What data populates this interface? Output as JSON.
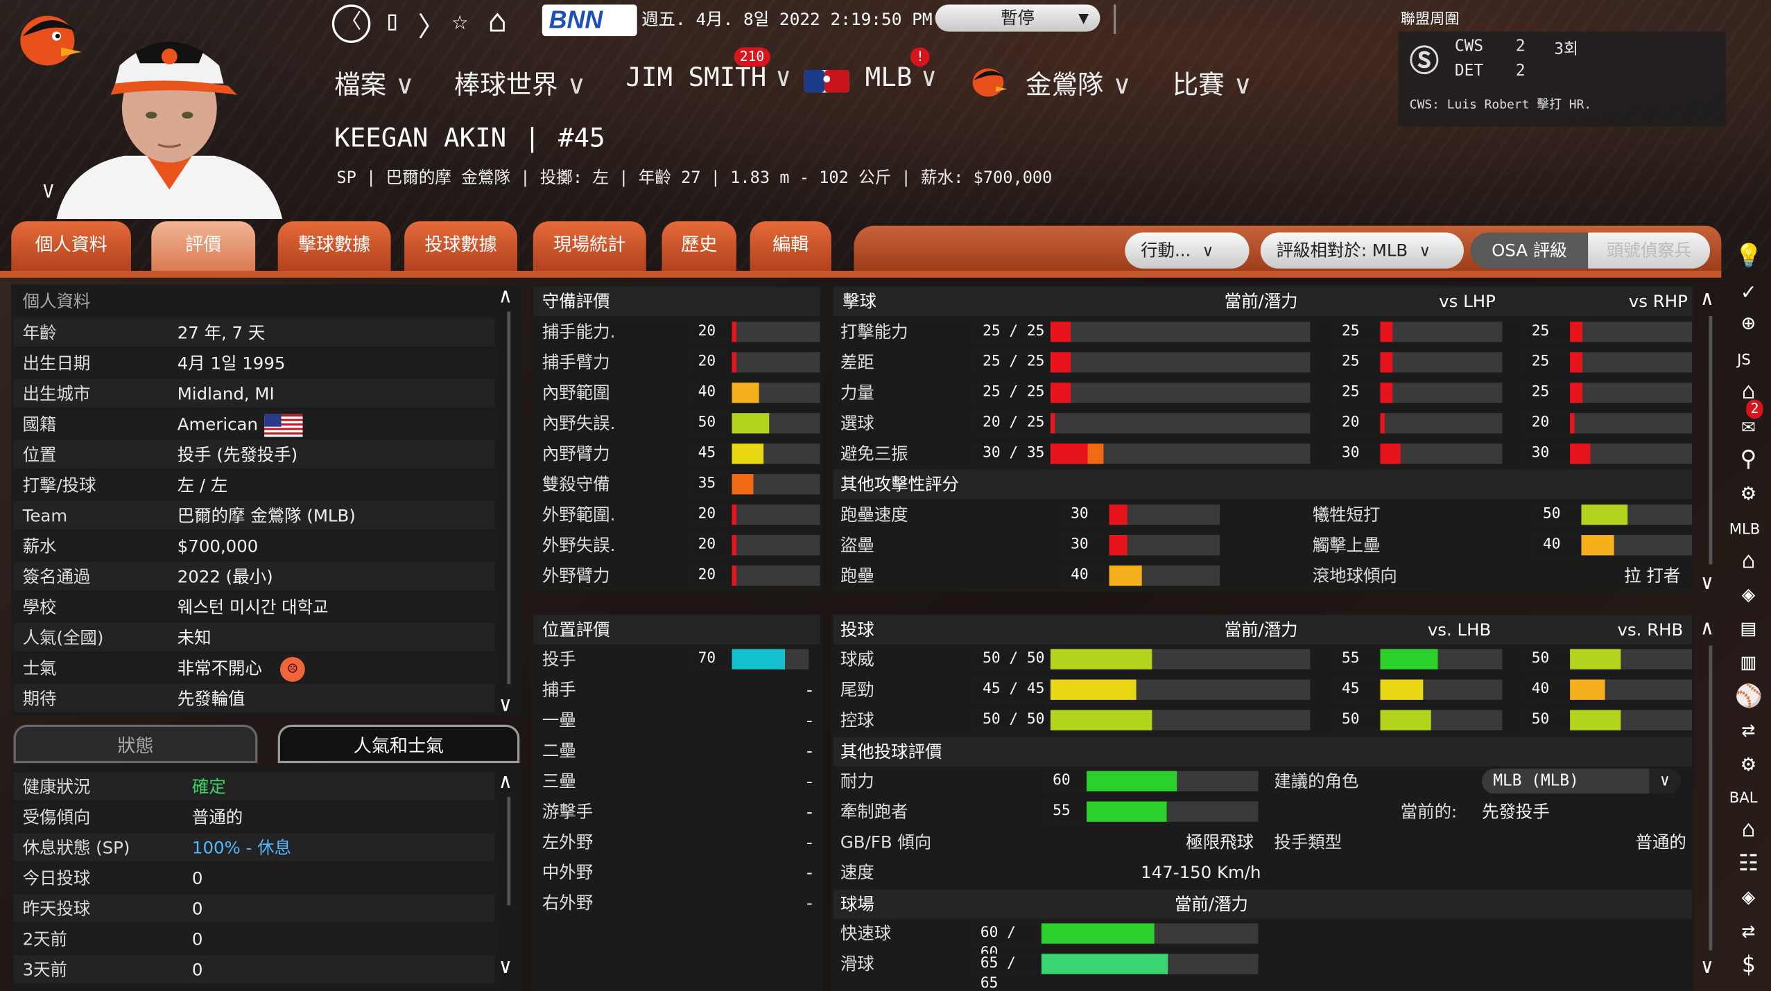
{
  "header": {
    "nav": {
      "back": "〈",
      "phone": "▯",
      "forward": "〉",
      "star": "☆",
      "home": "⌂"
    },
    "bnn": "BNN",
    "datetime": "週五. 4月. 8일 2022 2:19:50  PM",
    "pause": "暫停",
    "menu": [
      {
        "label": "檔案"
      },
      {
        "label": "棒球世界"
      },
      {
        "label": "JIM SMITH",
        "badge": "210"
      },
      {
        "label": "MLB",
        "badge": "!"
      },
      {
        "label": "金鶯隊"
      },
      {
        "label": "比賽"
      }
    ],
    "league_title": "聯盟周圍",
    "score": {
      "team1": "CWS",
      "score1": "2",
      "inning": "3회",
      "team2": "DET",
      "score2": "2",
      "note": "CWS: Luis Robert 擊打 HR."
    },
    "player_name": "KEEGAN AKIN",
    "number": "#45",
    "info_line": "SP  |  巴爾的摩 金鶯隊  |  投擲: 左  |  年齡 27  |  1.83 m - 102 公斤  |  薪水: $700,000",
    "player_v": "V"
  },
  "tabs": [
    "個人資料",
    "評價",
    "擊球數據",
    "投球數據",
    "現場統計",
    "歷史",
    "編輯"
  ],
  "actions": {
    "action": "行動...",
    "rating_vs": "評級相對於: MLB",
    "osa": "OSA 評級",
    "scout": "頭號偵察兵"
  },
  "personal": {
    "title": "個人資料",
    "rows": [
      {
        "k": "年齡",
        "v": "27 年, 7 天"
      },
      {
        "k": "出生日期",
        "v": "4月 1일 1995"
      },
      {
        "k": "出生城市",
        "v": "Midland, MI"
      },
      {
        "k": "國籍",
        "v": "American"
      },
      {
        "k": "位置",
        "v": "投手 (先發投手)"
      },
      {
        "k": "打擊/投球",
        "v": "左 / 左"
      },
      {
        "k": "Team",
        "v": "巴爾的摩 金鶯隊 (MLB)"
      },
      {
        "k": "薪水",
        "v": "$700,000"
      },
      {
        "k": "簽名通過",
        "v": "2022 (最小)"
      },
      {
        "k": "學校",
        "v": "웨스턴 미시간 대학교"
      },
      {
        "k": "人氣(全國)",
        "v": "未知"
      },
      {
        "k": "士氣",
        "v": "非常不開心"
      },
      {
        "k": "期待",
        "v": "先發輪值"
      }
    ]
  },
  "status_tabs": [
    "狀態",
    "人氣和士氣"
  ],
  "status": {
    "rows": [
      {
        "k": "健康狀況",
        "v": "確定",
        "color": "#39d36a"
      },
      {
        "k": "受傷傾向",
        "v": "普通的",
        "color": "#f0f0f0"
      },
      {
        "k": "休息狀態 (SP)",
        "v": "100% - 休息",
        "color": "#4fb8ff"
      },
      {
        "k": "今日投球",
        "v": "0",
        "color": "#f0f0f0"
      },
      {
        "k": "昨天投球",
        "v": "0",
        "color": "#f0f0f0"
      },
      {
        "k": "2天前",
        "v": "0",
        "color": "#f0f0f0"
      },
      {
        "k": "3天前",
        "v": "0",
        "color": "#f0f0f0"
      }
    ]
  },
  "defense": {
    "title": "守備評價",
    "rows": [
      {
        "k": "捕手能力.",
        "v": "20",
        "n": 20,
        "c": "#e8141c"
      },
      {
        "k": "捕手臂力",
        "v": "20",
        "n": 20,
        "c": "#e8141c"
      },
      {
        "k": "內野範圍",
        "v": "40",
        "n": 40,
        "c": "#f5b01c"
      },
      {
        "k": "內野失誤.",
        "v": "50",
        "n": 50,
        "c": "#b2d41c"
      },
      {
        "k": "內野臂力",
        "v": "45",
        "n": 45,
        "c": "#e8d814"
      },
      {
        "k": "雙殺守備",
        "v": "35",
        "n": 35,
        "c": "#f06a14"
      },
      {
        "k": "外野範圍.",
        "v": "20",
        "n": 20,
        "c": "#e8141c"
      },
      {
        "k": "外野失誤.",
        "v": "20",
        "n": 20,
        "c": "#e8141c"
      },
      {
        "k": "外野臂力",
        "v": "20",
        "n": 20,
        "c": "#e8141c"
      }
    ]
  },
  "position": {
    "title": "位置評價",
    "rows": [
      {
        "k": "投手",
        "v": "70",
        "n": 70
      },
      {
        "k": "捕手",
        "v": "-"
      },
      {
        "k": "一壘",
        "v": "-"
      },
      {
        "k": "二壘",
        "v": "-"
      },
      {
        "k": "三壘",
        "v": "-"
      },
      {
        "k": "游擊手",
        "v": "-"
      },
      {
        "k": "左外野",
        "v": "-"
      },
      {
        "k": "中外野",
        "v": "-"
      },
      {
        "k": "右外野",
        "v": "-"
      }
    ]
  },
  "batting": {
    "title": "擊球",
    "h1": "當前/潛力",
    "h2": "vs LHP",
    "h3": "vs RHP",
    "rows": [
      {
        "k": "打擊能力",
        "v": "25 / 25",
        "n": 25,
        "l": "25",
        "r": "25"
      },
      {
        "k": "差距",
        "v": "25 / 25",
        "n": 25,
        "l": "25",
        "r": "25"
      },
      {
        "k": "力量",
        "v": "25 / 25",
        "n": 25,
        "l": "25",
        "r": "25"
      },
      {
        "k": "選球",
        "v": "20 / 25",
        "n": 20,
        "l": "20",
        "r": "20"
      },
      {
        "k": "避免三振",
        "v": "30 / 35",
        "n": 30,
        "p": 35,
        "l": "30",
        "r": "30"
      }
    ],
    "other_title": "其他攻擊性評分",
    "other": [
      {
        "k": "跑壘速度",
        "v": "30",
        "n": 30,
        "c": "#e8141c"
      },
      {
        "k": "盜壘",
        "v": "30",
        "n": 30,
        "c": "#e8141c"
      },
      {
        "k": "跑壘",
        "v": "40",
        "n": 40,
        "c": "#f5b01c"
      }
    ],
    "other_right": [
      {
        "k": "犧牲短打",
        "v": "50",
        "n": 50,
        "c": "#b2d41c"
      },
      {
        "k": "觸擊上壘",
        "v": "40",
        "n": 40,
        "c": "#f5b01c"
      },
      {
        "k": "滾地球傾向",
        "v": "拉 打者"
      }
    ]
  },
  "pitching": {
    "title": "投球",
    "h1": "當前/潛力",
    "h2": "vs. LHB",
    "h3": "vs. RHB",
    "rows": [
      {
        "k": "球威",
        "v": "50 / 50",
        "n": 50,
        "c": "#b2d41c",
        "l": "55",
        "ln": 55,
        "lc": "#2bd02b",
        "r": "50",
        "rn": 50,
        "rc": "#b2d41c"
      },
      {
        "k": "尾勁",
        "v": "45 / 45",
        "n": 45,
        "c": "#e8d814",
        "l": "45",
        "ln": 45,
        "lc": "#e8d814",
        "r": "40",
        "rn": 40,
        "rc": "#f5b01c"
      },
      {
        "k": "控球",
        "v": "50 / 50",
        "n": 50,
        "c": "#b2d41c",
        "l": "50",
        "ln": 50,
        "lc": "#b2d41c",
        "r": "50",
        "rn": 50,
        "rc": "#b2d41c"
      }
    ],
    "other_title": "其他投球評價",
    "stamina": {
      "k": "耐力",
      "v": "60",
      "n": 60
    },
    "hold": {
      "k": "牽制跑者",
      "v": "55",
      "n": 55
    },
    "role_label": "建議的角色",
    "role_value": "MLB (MLB)",
    "current_label": "當前的:",
    "current_value": "先發投手",
    "gbfb_label": "GB/FB 傾向",
    "gbfb_value": "極限飛球",
    "type_label": "投手類型",
    "type_value": "普通的",
    "velo_label": "速度",
    "velo_value": "147-150 Km/h",
    "park_title": "球場",
    "park_h": "當前/潛力",
    "pitches": [
      {
        "k": "快速球",
        "v": "60 / 60",
        "n": 60,
        "c": "#2bd02b"
      },
      {
        "k": "滑球",
        "v": "65 / 65",
        "n": 65,
        "c": "#3ad470"
      }
    ]
  },
  "sidebar": {
    "js": "JS",
    "mlb": "MLB",
    "bal": "BAL",
    "mail_badge": "2"
  }
}
